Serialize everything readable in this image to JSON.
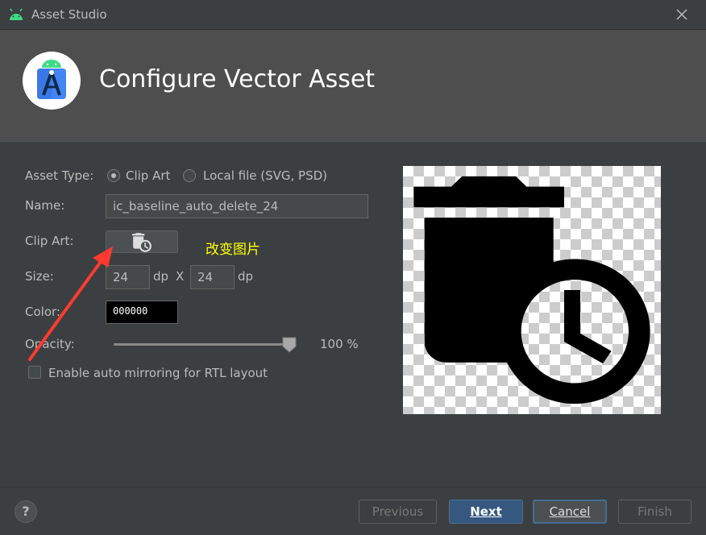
{
  "window": {
    "title": "Asset Studio"
  },
  "header": {
    "title": "Configure Vector Asset"
  },
  "form": {
    "asset_type_label": "Asset Type:",
    "asset_type_options": [
      "Clip Art",
      "Local file (SVG, PSD)"
    ],
    "asset_type_selected": "Clip Art",
    "name_label": "Name:",
    "name_value": "ic_baseline_auto_delete_24",
    "clip_art_label": "Clip Art:",
    "clip_art_icon": "auto-delete-icon",
    "annotation": "改变图片",
    "size_label": "Size:",
    "width_value": "24",
    "height_value": "24",
    "unit": "dp",
    "size_separator": "X",
    "color_label": "Color:",
    "color_value": "000000",
    "opacity_label": "Opacity:",
    "opacity_value": "100 %",
    "opacity_percent": 100,
    "mirroring_label": "Enable auto mirroring for RTL layout",
    "mirroring_checked": false
  },
  "preview": {
    "icon": "auto-delete-icon"
  },
  "footer": {
    "help_label": "?",
    "previous_label": "Previous",
    "next_label": "Next",
    "cancel_label": "Cancel",
    "finish_label": "Finish"
  },
  "colors": {
    "background": "#3c3f41",
    "header": "#4e4e4e",
    "primary_button": "#365880",
    "annotation": "#ffff00",
    "arrow": "#ff3b30"
  }
}
